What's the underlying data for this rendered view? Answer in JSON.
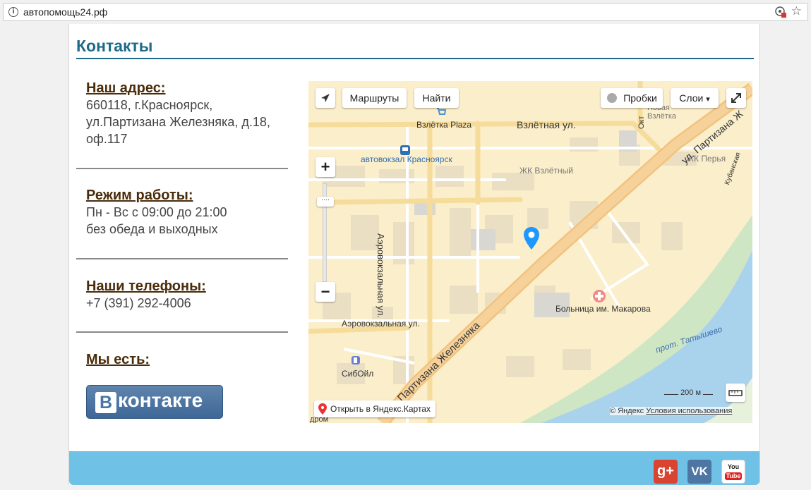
{
  "browser": {
    "url": "автопомощь24.рф"
  },
  "page": {
    "title": "Контакты"
  },
  "address": {
    "heading": "Наш адрес:",
    "line1": "660118, г.Красноярск,",
    "line2": "ул.Партизана Железняка, д.18,",
    "line3": "оф.117"
  },
  "hours": {
    "heading": "Режим работы:",
    "line1": "Пн - Вс с 09:00 до 21:00",
    "line2": "без обеда и выходных"
  },
  "phones": {
    "heading": "Наши телефоны:",
    "line1": "+7 (391) 292-4006"
  },
  "social": {
    "heading": "Мы есть:",
    "vk_letter": "В",
    "vk_word": "контакте"
  },
  "map": {
    "routes_button": "Маршруты",
    "find_button": "Найти",
    "traffic_button": "Пробки",
    "layers_button": "Слои",
    "zoom_in": "+",
    "zoom_out": "−",
    "open_link": "Открыть в Яндекс.Картах",
    "copyright": "© Яндекс",
    "terms": "Условия использования",
    "scale": "200 м",
    "labels": {
      "vzletka": "Взлётка Plaza",
      "vzletnaya": "Взлётная ул.",
      "avtovokzal": "автовокзал Красноярск",
      "zhk_vzletny": "ЖК Взлётный",
      "zhk_perya": "ЖК Перья",
      "novaya": "Новая",
      "vzletka2": "Взлётка",
      "aero_street": "Аэровокзальная ул.",
      "aero_street2": "Аэровокзальная ул.",
      "partizana": "Партизана Железняка",
      "partizana2": "ул. Партизана Ж",
      "hospital": "Больница им. Макарова",
      "tatyshevo": "прот. Татышево",
      "siboil": "СибОйл",
      "kubanskaya": "Кубанская",
      "okt": "Окт",
      "podrom": "дром"
    }
  },
  "footer": {
    "gplus": "g+",
    "vk": "VK",
    "youtube_top": "You",
    "youtube_bottom": "Tube"
  },
  "colors": {
    "accent": "#1d6a8a",
    "heading_brown": "#4a2c0a",
    "footer": "#6fc2e6"
  }
}
